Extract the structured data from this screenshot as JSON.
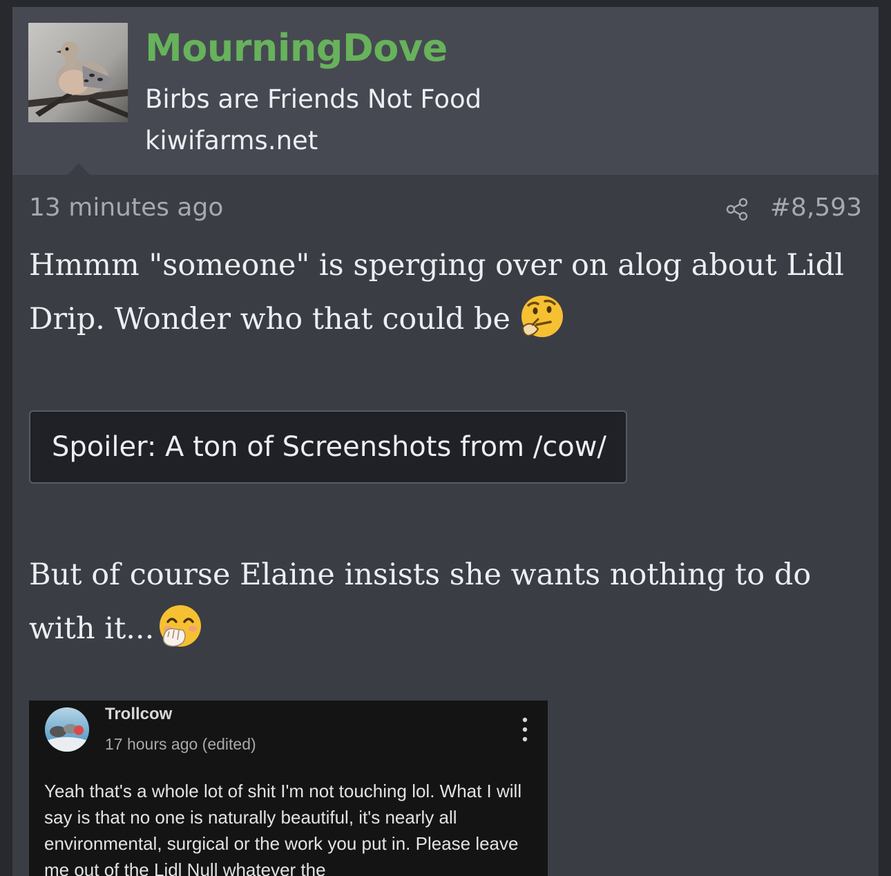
{
  "author": {
    "username": "MourningDove",
    "tagline": "Birbs are Friends Not Food",
    "site": "kiwifarms.net",
    "avatar_icon": "mourning-dove-photo"
  },
  "post": {
    "timestamp": "13 minutes ago",
    "share_icon": "share-icon",
    "number": "#8,593",
    "paragraph1": "Hmmm \"someone\" is sperging over on alog about Lidl Drip. Wonder who that could be",
    "paragraph1_emoji": "thinking-face",
    "spoiler_label": "Spoiler: A ton of Screenshots from /cow/",
    "paragraph2": "But of course Elaine insists she wants nothing to do with it...",
    "paragraph2_emoji": "face-with-hand-over-mouth"
  },
  "embedded_screenshot": {
    "username": "Trollcow",
    "time": "17 hours ago (edited)",
    "text": "Yeah that's a whole lot of shit I'm not touching lol. What I will say is that no one is naturally beautiful, it's nearly all environmental, surgical or the work you put in. Please leave me out of the Lidl Null whatever the"
  },
  "colors": {
    "username": "#67b25b",
    "header_bg": "#464952",
    "post_bg": "#3b3d45",
    "spoiler_bg": "#1f2126"
  }
}
